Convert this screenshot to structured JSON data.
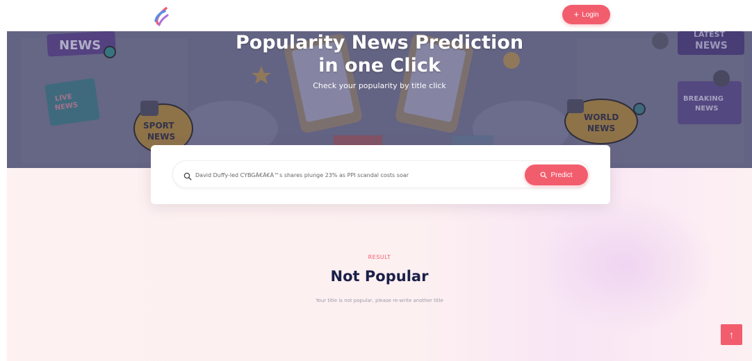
{
  "header": {
    "login_label": "Login",
    "login_icon": "plus-icon"
  },
  "hero": {
    "title_line1": "Popularity News Prediction",
    "title_line2": "in one Click",
    "subtitle": "Check your popularity by title click",
    "stickers": {
      "news": "NEWS",
      "live_news_1": "LIVE",
      "live_news_2": "NEWS",
      "sport_news_1": "SPORT",
      "sport_news_2": "NEWS",
      "latest_news_1": "LATEST",
      "latest_news_2": "NEWS",
      "breaking_news_1": "BREAKING",
      "breaking_news_2": "NEWS",
      "world_news_1": "WORLD",
      "world_news_2": "NEWS"
    }
  },
  "search": {
    "value": "David Duffy-led CYBGÃ€Ã€Â™s shares plunge 23% as PPI scandal costs soar",
    "icon": "search-icon",
    "predict_label": "Predict"
  },
  "result": {
    "label": "RESULT",
    "title": "Not Popular",
    "description": "Your title is not popular, please re-write another title"
  },
  "back_to_top_icon": "arrow-up-icon",
  "colors": {
    "accent": "#f25d6e",
    "title": "#1b2048",
    "hero_overlay": "#6d6c8a",
    "lower_bg": "#fdf1f1"
  }
}
